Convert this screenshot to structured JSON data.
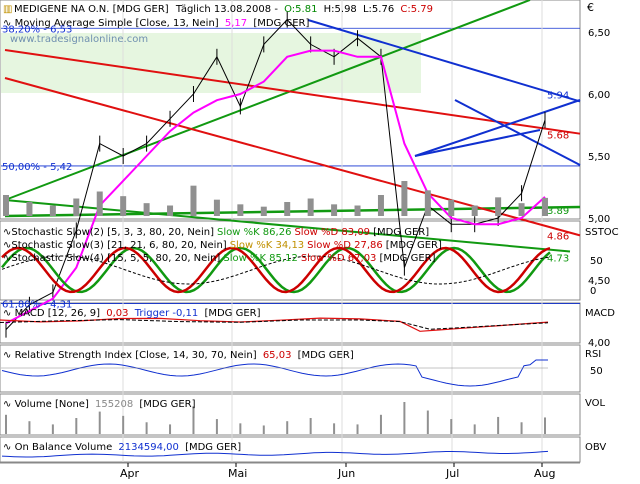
{
  "window": {
    "title": "MEDIGENE NA O.N. [MDG GER] Täglich 13.08.2008 - O:5.81 H:5.98 L:5.76 C:5.79"
  },
  "price_panel": {
    "header": "MEDIGENE NA O.N. [MDG GER]",
    "header_rest": "Täglich 13.08.2008 -",
    "ohlc": {
      "open": "O:5.81",
      "high": "H:5.98",
      "low": "L:5.76",
      "close": "C:5.79"
    },
    "ma_label": "Moving Average Simple [Close, 13, Nein]",
    "ma_value": "5,17",
    "ma_suffix": "[MDG GER]",
    "watermark": "www.tradesignalonline.com",
    "currency": "€",
    "fib_labels": [
      "38,20% - 6,53",
      "50,00% - 5,42",
      "61,80% - 4,31"
    ],
    "value_tags": [
      "5.94",
      "5.68",
      "4.86",
      "4.73",
      "3.89"
    ],
    "yticks": [
      "6,50",
      "6,00",
      "5,50",
      "5,00",
      "4,50",
      "4,00"
    ]
  },
  "stoch_panel": {
    "label": "SSTOC",
    "lines": [
      {
        "text": "Stochastic Slow(2) [5, 3, 3, 80, 20, Nein]",
        "k": "Slow %K 86,26",
        "d": "Slow %D 83,09",
        "suffix": "[MDG GER]"
      },
      {
        "text": "Stochastic Slow(3) [21, 21, 6, 80, 20, Nein]",
        "k": "Slow %K 34,13",
        "d": "Slow %D 27,86",
        "suffix": "[MDG GER]"
      },
      {
        "text": "Stochastic Slow(4) [15, 5, 5, 80, 20, Nein]",
        "k": "Slow %K 85,12",
        "d": "Slow %D 67,03",
        "suffix": "[MDG GER]"
      }
    ],
    "yticks": [
      "50",
      "0"
    ]
  },
  "macd_panel": {
    "label": "MACD",
    "text": "MACD [12, 26, 9]",
    "value": "0,03",
    "trigger": "Trigger -0,11",
    "suffix": "[MDG GER]"
  },
  "rsi_panel": {
    "label": "RSI",
    "text": "Relative Strength Index [Close, 14, 30, 70, Nein]",
    "value": "65,03",
    "suffix": "[MDG GER]",
    "ytick": "50"
  },
  "volume_panel": {
    "label": "VOL",
    "text": "Volume [None]",
    "value": "155208",
    "suffix": "[MDG GER]"
  },
  "obv_panel": {
    "label": "OBV",
    "text": "On Balance Volume",
    "value": "2134594,00",
    "suffix": "[MDG GER]"
  },
  "x_axis": {
    "months": [
      "Apr",
      "Mai",
      "Jun",
      "Jul",
      "Aug"
    ]
  },
  "colors": {
    "price": "#000000",
    "ma": "#ff00ff",
    "green_trend": "#119911",
    "red_trend": "#e01010",
    "blue_trend": "#1030d0",
    "macd_signal": "#e01010",
    "rsi": "#1030d0",
    "label_red": "#cc0000",
    "label_blue": "#1030d0"
  },
  "chart_data": {
    "type": "line",
    "title": "MEDIGENE NA O.N. [MDG GER] Täglich 13.08.2008",
    "x": [
      "2008-03-06",
      "2008-03-13",
      "2008-03-20",
      "2008-03-27",
      "2008-04-03",
      "2008-04-10",
      "2008-04-17",
      "2008-04-24",
      "2008-05-01",
      "2008-05-08",
      "2008-05-15",
      "2008-05-22",
      "2008-05-29",
      "2008-06-05",
      "2008-06-12",
      "2008-06-19",
      "2008-06-26",
      "2008-07-03",
      "2008-07-10",
      "2008-07-17",
      "2008-07-24",
      "2008-07-31",
      "2008-08-07",
      "2008-08-13"
    ],
    "series": [
      {
        "name": "Close",
        "values": [
          4.1,
          4.3,
          4.4,
          4.9,
          5.6,
          5.5,
          5.6,
          5.8,
          6.0,
          6.3,
          5.9,
          6.4,
          6.6,
          6.4,
          6.3,
          6.45,
          6.3,
          4.6,
          5.1,
          4.95,
          4.95,
          5.0,
          5.2,
          5.79
        ]
      },
      {
        "name": "Moving Average Simple [Close, 13, Nein]",
        "values": [
          4.15,
          4.25,
          4.35,
          4.6,
          5.1,
          5.3,
          5.5,
          5.7,
          5.85,
          5.95,
          6.0,
          6.1,
          6.3,
          6.35,
          6.35,
          6.3,
          6.3,
          5.6,
          5.2,
          5.0,
          4.95,
          4.95,
          5.0,
          5.17
        ]
      }
    ],
    "ylim": [
      3.8,
      6.8
    ],
    "trendlines_end_values": {
      "blue_upper": 5.94,
      "red_upper": 5.68,
      "red_lower": 4.86,
      "green_lower": 4.73,
      "green_base": 3.89
    },
    "fibonacci": [
      {
        "level": "38,20%",
        "value": 6.53
      },
      {
        "level": "50,00%",
        "value": 5.42
      },
      {
        "level": "61,80%",
        "value": 4.31
      }
    ],
    "volume": [
      180000,
      120000,
      90000,
      150000,
      210000,
      170000,
      110000,
      90000,
      260000,
      140000,
      100000,
      80000,
      120000,
      150000,
      100000,
      90000,
      180000,
      300000,
      220000,
      140000,
      90000,
      160000,
      110000,
      155208
    ],
    "indicators": {
      "stoch2_k": 86.26,
      "stoch2_d": 83.09,
      "stoch3_k": 34.13,
      "stoch3_d": 27.86,
      "stoch4_k": 85.12,
      "stoch4_d": 67.03,
      "macd": 0.03,
      "macd_trigger": -0.11,
      "rsi": 65.03,
      "volume_last": 155208,
      "obv": 2134594.0
    }
  }
}
